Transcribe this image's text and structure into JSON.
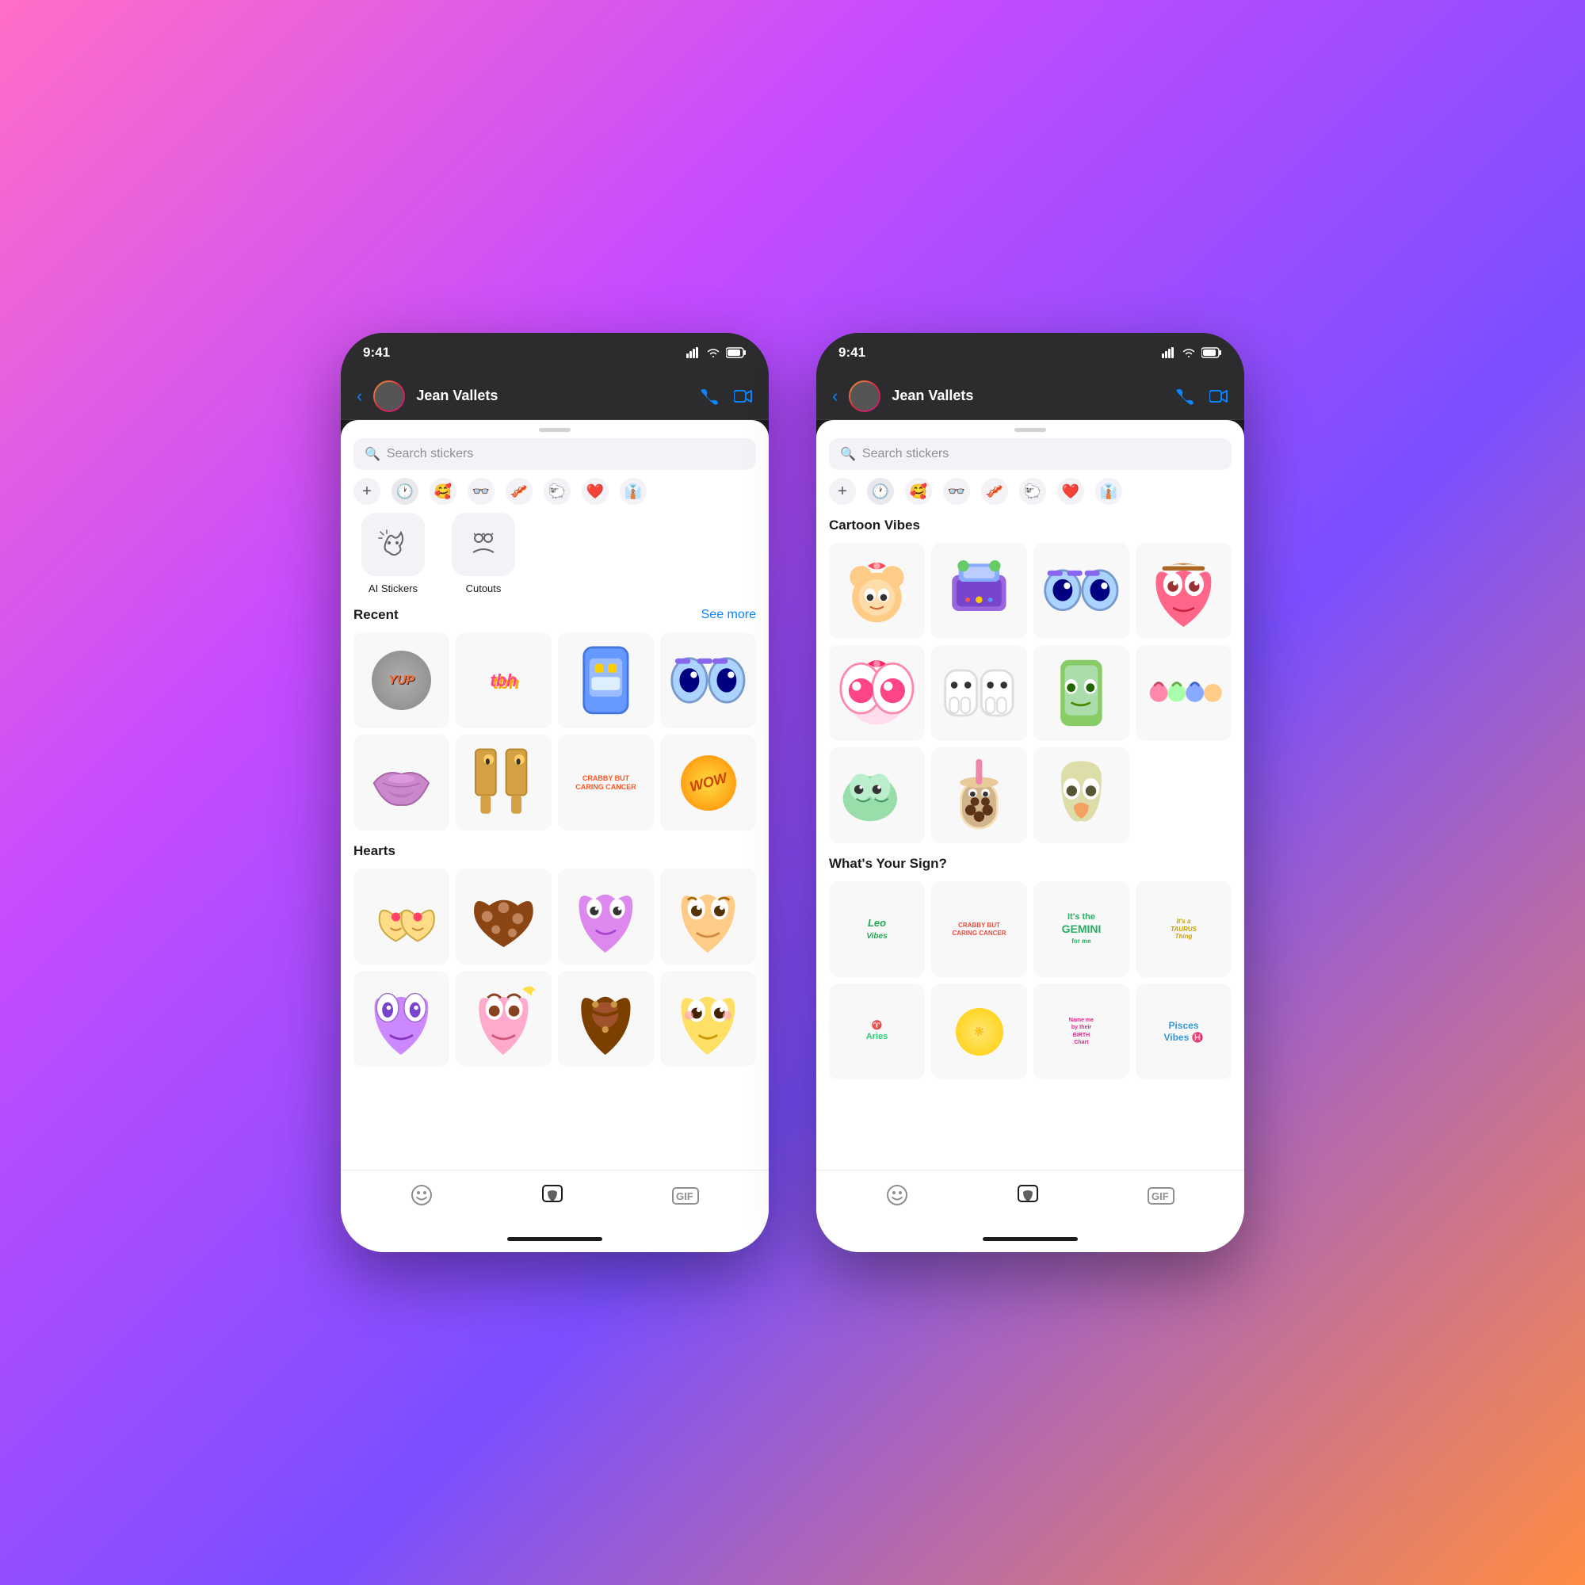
{
  "background": "gradient",
  "phones": [
    {
      "id": "phone-left",
      "status_bar": {
        "time": "9:41",
        "signal": "●●●●",
        "wifi": "wifi",
        "battery": "battery"
      },
      "nav": {
        "back_label": "‹",
        "user_name": "Jean Vallets",
        "call_icon": "phone",
        "video_icon": "square"
      },
      "search": {
        "placeholder": "Search stickers"
      },
      "tabs": [
        "+",
        "🕐",
        "🥰",
        "👓",
        "🥓",
        "🐑",
        "❤️",
        "👔"
      ],
      "special_items": [
        {
          "icon": "✂️✨",
          "label": "AI Stickers"
        },
        {
          "icon": "✂️",
          "label": "Cutouts"
        }
      ],
      "recent_section": {
        "title": "Recent",
        "see_more": "See more",
        "stickers": [
          "yup",
          "tbh",
          "portal",
          "eyes",
          "lips",
          "legs",
          "crabby",
          "wow"
        ]
      },
      "hearts_section": {
        "title": "Hearts",
        "stickers": [
          "heart-eyes-1",
          "heart-cookie",
          "heart-face",
          "heart-glam",
          "alien-heart",
          "heart-fairy",
          "pretzel-heart",
          "heart-cute"
        ]
      },
      "bottom_tabs": [
        "emoji",
        "sticker",
        "gif"
      ]
    },
    {
      "id": "phone-right",
      "status_bar": {
        "time": "9:41"
      },
      "nav": {
        "user_name": "Jean Vallets"
      },
      "search": {
        "placeholder": "Search stickers"
      },
      "cartoon_section": {
        "title": "Cartoon Vibes",
        "stickers": [
          "strawberry-bear",
          "gaming-croc",
          "cool-eyes",
          "heart-cowgirl",
          "big-eyes",
          "tooth-friends",
          "phone-guy",
          "friendship-chain",
          "cloud-duo",
          "boba",
          "ghost-heart"
        ]
      },
      "sign_section": {
        "title": "What's Your Sign?",
        "stickers": [
          "leo",
          "cancer",
          "gemini",
          "taurus",
          "aries",
          "libra",
          "birth",
          "pisces"
        ]
      },
      "bottom_tabs": [
        "emoji",
        "sticker",
        "gif"
      ]
    }
  ]
}
